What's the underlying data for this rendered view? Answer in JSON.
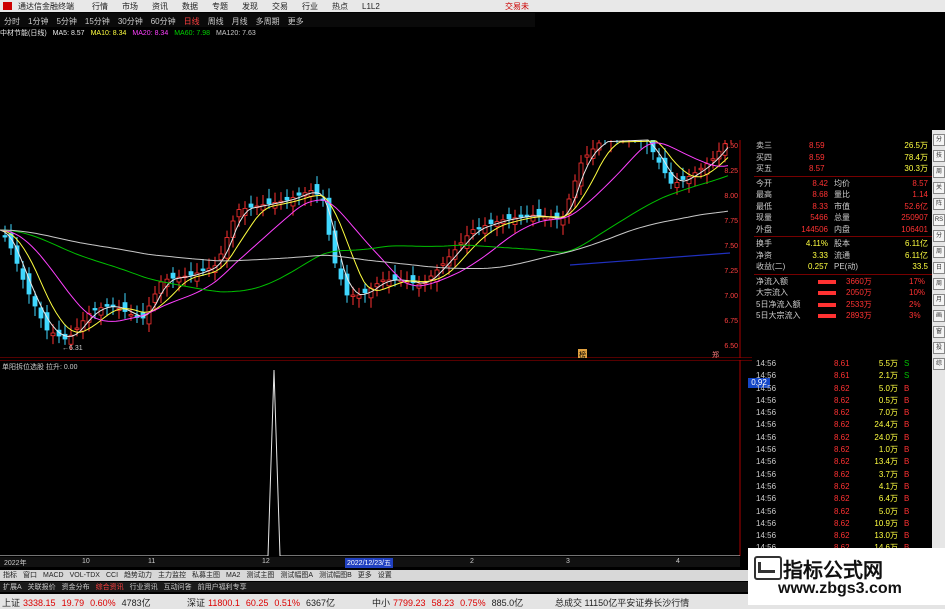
{
  "app": {
    "title": "通达信金融终端",
    "right_label": "交易未"
  },
  "menu": [
    "行情",
    "市场",
    "资讯",
    "数据",
    "专题",
    "发现",
    "交易",
    "行业",
    "热点",
    "L1L2"
  ],
  "periods": {
    "items": [
      "分时",
      "1分钟",
      "5分钟",
      "15分钟",
      "30分钟",
      "60分钟",
      "日线",
      "周线",
      "月线",
      "多周期",
      "更多"
    ],
    "active": "日线"
  },
  "ma_row": {
    "name": "中材节能(日线)",
    "items": [
      {
        "label": "MA5: 8.57",
        "color": "#e8e8e8"
      },
      {
        "label": "MA10: 8.34",
        "color": "#ffff40"
      },
      {
        "label": "MA20: 8.34",
        "color": "#ff40ff"
      },
      {
        "label": "MA60: 7.98",
        "color": "#00d000"
      },
      {
        "label": "MA120: 7.63",
        "color": "#c8c8c8"
      }
    ]
  },
  "chart": {
    "price_labels": [
      "8.50",
      "8.25",
      "8.00",
      "7.75",
      "7.50",
      "7.25",
      "7.00",
      "6.75",
      "6.50"
    ],
    "low_marker": "6.31",
    "markers": [
      "榜",
      "郑"
    ],
    "sub_label": "单阳拆位选股  拉升: 0.00",
    "sub_ticks": [
      "1.00",
      "0.90",
      "0.80",
      "0.70",
      "0.60",
      "0.50",
      "0.40",
      "0.30",
      "0.20",
      "0.10"
    ],
    "sub_value": "0.92",
    "dates": [
      "2022年",
      "10",
      "11",
      "12",
      "2022/12/23/五",
      "2",
      "3",
      "4"
    ]
  },
  "quote": {
    "asks": [
      {
        "label": "卖三",
        "price": "8.59",
        "vol": "26.5万"
      },
      {
        "label": "买四",
        "price": "8.59",
        "vol": "78.4万"
      },
      {
        "label": "买五",
        "price": "8.57",
        "vol": "30.3万"
      }
    ],
    "stats": [
      {
        "k1": "今开",
        "v1": "8.42",
        "k2": "均价",
        "v2": "8.57"
      },
      {
        "k1": "最高",
        "v1": "8.68",
        "k2": "量比",
        "v2": "1.14"
      },
      {
        "k1": "最低",
        "v1": "8.33",
        "k2": "市值",
        "v2": "52.6亿"
      },
      {
        "k1": "现量",
        "v1": "5466",
        "k2": "总量",
        "v2": "250907"
      },
      {
        "k1": "外盘",
        "v1": "144506",
        "k2": "内盘",
        "v2": "106401"
      }
    ],
    "stats2": [
      {
        "k1": "换手",
        "v1": "4.11%",
        "k2": "股本",
        "v2": "6.11亿"
      },
      {
        "k1": "净资",
        "v1": "3.33",
        "k2": "流通",
        "v2": "6.11亿"
      },
      {
        "k1": "收益(二)",
        "v1": "0.257",
        "k2": "PE(动)",
        "v2": "33.5"
      }
    ],
    "flows": [
      {
        "label": "净流入额",
        "value": "3660万",
        "pct": "17%"
      },
      {
        "label": "大宗流入",
        "value": "2050万",
        "pct": "10%"
      },
      {
        "label": "5日净流入额",
        "value": "2533万",
        "pct": "2%"
      },
      {
        "label": "5日大宗流入",
        "value": "2893万",
        "pct": "3%"
      }
    ],
    "ticks": [
      {
        "t": "14:56",
        "p": "8.61",
        "v": "5.5万",
        "f": "S"
      },
      {
        "t": "14:56",
        "p": "8.61",
        "v": "2.1万",
        "f": "S"
      },
      {
        "t": "14:56",
        "p": "8.62",
        "v": "5.0万",
        "f": "B"
      },
      {
        "t": "14:56",
        "p": "8.62",
        "v": "0.5万",
        "f": "B"
      },
      {
        "t": "14:56",
        "p": "8.62",
        "v": "7.0万",
        "f": "B"
      },
      {
        "t": "14:56",
        "p": "8.62",
        "v": "24.4万",
        "f": "B"
      },
      {
        "t": "14:56",
        "p": "8.62",
        "v": "24.0万",
        "f": "B"
      },
      {
        "t": "14:56",
        "p": "8.62",
        "v": "1.0万",
        "f": "B"
      },
      {
        "t": "14:56",
        "p": "8.62",
        "v": "13.4万",
        "f": "B"
      },
      {
        "t": "14:56",
        "p": "8.62",
        "v": "3.7万",
        "f": "B"
      },
      {
        "t": "14:56",
        "p": "8.62",
        "v": "4.1万",
        "f": "B"
      },
      {
        "t": "14:56",
        "p": "8.62",
        "v": "6.4万",
        "f": "B"
      },
      {
        "t": "14:56",
        "p": "8.62",
        "v": "5.0万",
        "f": "B"
      },
      {
        "t": "14:56",
        "p": "8.62",
        "v": "10.9万",
        "f": "B"
      },
      {
        "t": "14:56",
        "p": "8.62",
        "v": "13.0万",
        "f": "B"
      },
      {
        "t": "14:56",
        "p": "8.62",
        "v": "14.6万",
        "f": "B"
      },
      {
        "t": "14:56",
        "p": "8.62",
        "v": "14.6万",
        "f": "B"
      }
    ]
  },
  "bottom_tabs": [
    "指标",
    "窗口",
    "MACD",
    "VOL-TDX",
    "CCI",
    "趋势动力",
    "主力监控",
    "私募主图",
    "MA2",
    "测试主图",
    "测试幅图A",
    "测试幅图B",
    "更多",
    "设置"
  ],
  "bottom_tabs2": [
    "扩展A",
    "关联报价",
    "资金分布",
    "综合资讯",
    "行业资讯",
    "互动问答",
    "前用户福利专享"
  ],
  "status": [
    {
      "name": "上证",
      "value": "3338.15",
      "chg": "19.79",
      "pct": "0.60%",
      "amt": "4783亿"
    },
    {
      "name": "深证",
      "value": "11800.1",
      "chg": "60.25",
      "pct": "0.51%",
      "amt": "6367亿"
    },
    {
      "name": "中小",
      "value": "7799.23",
      "chg": "58.23",
      "pct": "0.75%",
      "amt": "885.0亿"
    }
  ],
  "status_tail": "总成交 11150亿平安证券长沙行情",
  "watermark": {
    "line1": "指标公式网",
    "line2": "www.zbgs3.com"
  },
  "right_toolbar": [
    "分",
    "技",
    "周",
    "关",
    "阵",
    "RS",
    "分",
    "周",
    "日",
    "周",
    "月",
    "画",
    "窗",
    "投",
    "综"
  ]
}
